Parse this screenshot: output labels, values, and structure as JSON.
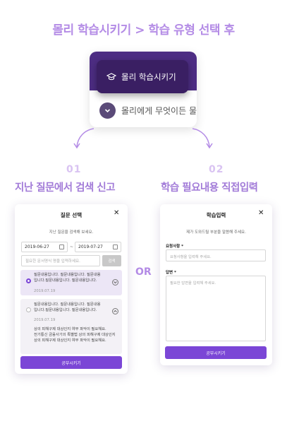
{
  "header": {
    "title": "몰리 학습시키기 > 학습 유형 선택 후"
  },
  "menu": {
    "item1_label": "몰리 학습시키기",
    "item1_icon": "graduation-cap-icon",
    "item2_label": "몰리에게 무엇이든 물",
    "item2_icon": "chevron-down-icon"
  },
  "steps": [
    {
      "num": "01",
      "title": "지난 질문에서 검색 신고"
    },
    {
      "num": "02",
      "title": "학습 필요내용 직접입력"
    }
  ],
  "or_label": "OR",
  "left_modal": {
    "title": "질문 선택",
    "close": "✕",
    "description": "지난 질문을 검색해 보세요.",
    "date_from": "2019-06-27",
    "date_to": "2019-07-27",
    "date_sep": "~",
    "search_placeholder": "필요한 문서명식 명을 입력하세요.",
    "search_button": "검색",
    "items": [
      {
        "text_l1": "질문내용입니다. 질문내용입니다. 질문내용",
        "text_l2": "입니다.질문내용입니다. 질문내용입니다.",
        "date": "2019.07.19",
        "selected": true
      },
      {
        "text_l1": "질문내용입니다. 질문내용입니다. 질문내용",
        "text_l2": "입니다.질문내용입니다. 질문내용입니다.",
        "date": "2019.07.19",
        "selected": false,
        "answer_l1": "상의 피해구제 대상인지 여부 파악이 필요해요.",
        "answer_l2": "전기통신 금융사기의 특별법 상의 피해구제 대상인지",
        "answer_l3": "상의 피해구제 대상인지 여부 파악이 필요해요."
      }
    ],
    "submit": "공부시키기"
  },
  "right_modal": {
    "title": "학습입력",
    "close": "✕",
    "description": "제가 도와드릴 부분을 말씀해 주세요.",
    "field1_label": "요청사항 *",
    "field1_placeholder": "요청사항을 입력해 주세요.",
    "field2_label": "답변 *",
    "field2_placeholder": "필요한 답변을 입력해 주세요.",
    "submit": "공부시키기"
  },
  "colors": {
    "accent": "#7b46d6",
    "title": "#b48ce6",
    "dark": "#3a1f63"
  }
}
